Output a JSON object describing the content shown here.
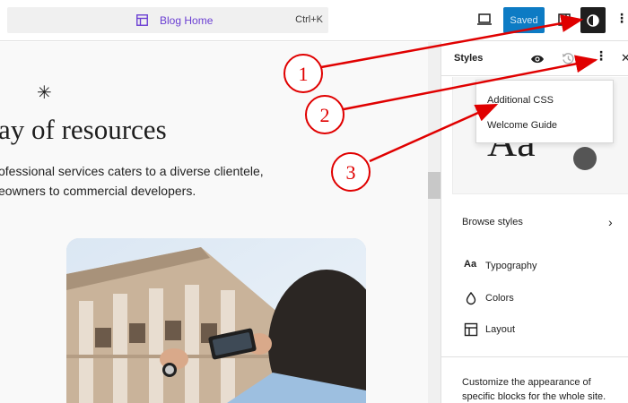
{
  "topbar": {
    "document_title": "Blog Home",
    "shortcut": "Ctrl+K",
    "save_label": "Saved",
    "more_icon": "⋮"
  },
  "canvas": {
    "asterisk": "✳",
    "headline": "ay of resources",
    "body_line_1": "ofessional services caters to a diverse clientele,",
    "body_line_2": "eowners to commercial developers."
  },
  "panel": {
    "title": "Styles",
    "more_icon": "⋮",
    "close_icon": "✕",
    "preview_text": "Aa",
    "browse_label": "Browse styles",
    "browse_chevron": "›",
    "items": [
      {
        "icon": "Aa",
        "label": "Typography"
      },
      {
        "icon": "",
        "label": "Colors"
      },
      {
        "icon": "",
        "label": "Layout"
      }
    ],
    "footer": "Customize the appearance of specific blocks for the whole site."
  },
  "menu": {
    "items": [
      "Additional CSS",
      "Welcome Guide"
    ]
  },
  "annotations": {
    "labels": [
      "1",
      "2",
      "3"
    ],
    "color": "#e00000"
  },
  "colors": {
    "accent_purple": "#6b3fd3",
    "save_blue": "#0d7bc4",
    "annotation_red": "#e00000"
  }
}
